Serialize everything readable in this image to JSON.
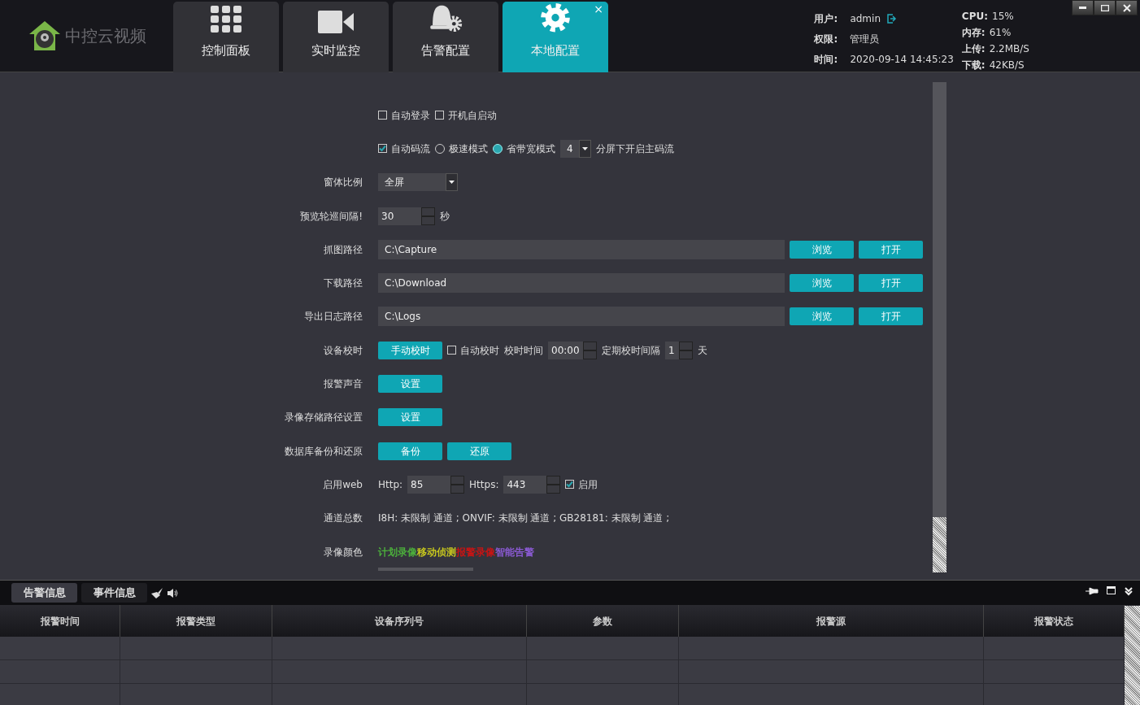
{
  "header": {
    "logo_text": "中控云视频",
    "tabs": [
      {
        "label": "控制面板",
        "selected": false
      },
      {
        "label": "实时监控",
        "selected": false
      },
      {
        "label": "告警配置",
        "selected": false
      },
      {
        "label": "本地配置",
        "selected": true,
        "close": "×"
      }
    ],
    "info": [
      {
        "label": "用户:",
        "value": "admin"
      },
      {
        "label": "权限:",
        "value": "管理员"
      },
      {
        "label": "时间:",
        "value": "2020-09-14 14:45:23"
      }
    ],
    "stats": [
      {
        "label": "CPU:",
        "value": "15%"
      },
      {
        "label": "内存:",
        "value": "61%"
      },
      {
        "label": "上传:",
        "value": "2.2MB/S"
      },
      {
        "label": "下载:",
        "value": "42KB/S"
      }
    ]
  },
  "settings": [
    {
      "items": [
        {
          "kind": "checkbox",
          "label": "自动登录",
          "checked": false
        },
        {
          "kind": "checkbox",
          "label": "开机自启动",
          "checked": false
        }
      ]
    },
    {
      "items": [
        {
          "kind": "checkbox",
          "label": "自动码流",
          "checked": true
        },
        {
          "kind": "radio",
          "label": "极速模式",
          "selected": false
        },
        {
          "kind": "radio",
          "label": "省带宽模式",
          "selected": true
        },
        {
          "kind": "select",
          "value": "4"
        },
        {
          "kind": "text",
          "text": "分屏下开启主码流"
        }
      ]
    },
    {
      "label": "窗体比例",
      "items": [
        {
          "kind": "select",
          "value": "全屏"
        }
      ]
    },
    {
      "label": "预览轮巡间隔!",
      "items": [
        {
          "kind": "spin",
          "value": "30"
        },
        {
          "kind": "text",
          "text": "秒"
        }
      ]
    },
    {
      "label": "抓图路径",
      "items": [
        {
          "kind": "field",
          "value": "C:\\Capture"
        },
        {
          "kind": "button",
          "text": "浏览"
        },
        {
          "kind": "button",
          "text": "打开"
        }
      ]
    },
    {
      "label": "下载路径",
      "items": [
        {
          "kind": "field",
          "value": "C:\\Download"
        },
        {
          "kind": "button",
          "text": "浏览"
        },
        {
          "kind": "button",
          "text": "打开"
        }
      ]
    },
    {
      "label": "导出日志路径",
      "items": [
        {
          "kind": "field",
          "value": "C:\\Logs"
        },
        {
          "kind": "button",
          "text": "浏览"
        },
        {
          "kind": "button",
          "text": "打开"
        }
      ]
    },
    {
      "label": "设备校时",
      "items": [
        {
          "kind": "button",
          "text": "手动校时"
        },
        {
          "kind": "checkbox",
          "label": "自动校时",
          "checked": false
        },
        {
          "kind": "text",
          "text": "校时时间"
        },
        {
          "kind": "spin",
          "value": "00:00"
        },
        {
          "kind": "text",
          "text": "定期校时间隔"
        },
        {
          "kind": "spin",
          "value": "1"
        },
        {
          "kind": "text",
          "text": "天"
        }
      ]
    },
    {
      "label": "报警声音",
      "items": [
        {
          "kind": "button",
          "text": "设置"
        }
      ]
    },
    {
      "label": "录像存储路径设置",
      "items": [
        {
          "kind": "button",
          "text": "设置"
        }
      ]
    },
    {
      "label": "数据库备份和还原",
      "items": [
        {
          "kind": "button",
          "text": "备份"
        },
        {
          "kind": "button",
          "text": "还原"
        }
      ]
    },
    {
      "label": "启用web",
      "items": [
        {
          "kind": "text",
          "text": "Http:"
        },
        {
          "kind": "spin",
          "value": "85"
        },
        {
          "kind": "text",
          "text": "Https:"
        },
        {
          "kind": "spin",
          "value": "443"
        },
        {
          "kind": "checkbox",
          "label": "启用",
          "checked": true
        }
      ]
    },
    {
      "label": "通道总数",
      "items": [
        {
          "kind": "text",
          "text": "I8H: 未限制 通道 ;  ONVIF: 未限制 通道 ;  GB28181: 未限制 通道 ;"
        }
      ]
    },
    {
      "label": "录像颜色",
      "items": [
        {
          "kind": "colors",
          "entries": [
            {
              "text": "计划录像",
              "color": "#4caf3c"
            },
            {
              "text": "移动侦测",
              "color": "#c8c81e"
            },
            {
              "text": "报警录像",
              "color": "#c81414"
            },
            {
              "text": "智能告警",
              "color": "#8a5ad2"
            }
          ]
        }
      ]
    }
  ],
  "bottom": {
    "tabs": [
      {
        "label": "告警信息",
        "selected": true
      },
      {
        "label": "事件信息",
        "selected": false
      }
    ],
    "columns": [
      "报警时间",
      "报警类型",
      "设备序列号",
      "参数",
      "报警源",
      "报警状态"
    ]
  }
}
